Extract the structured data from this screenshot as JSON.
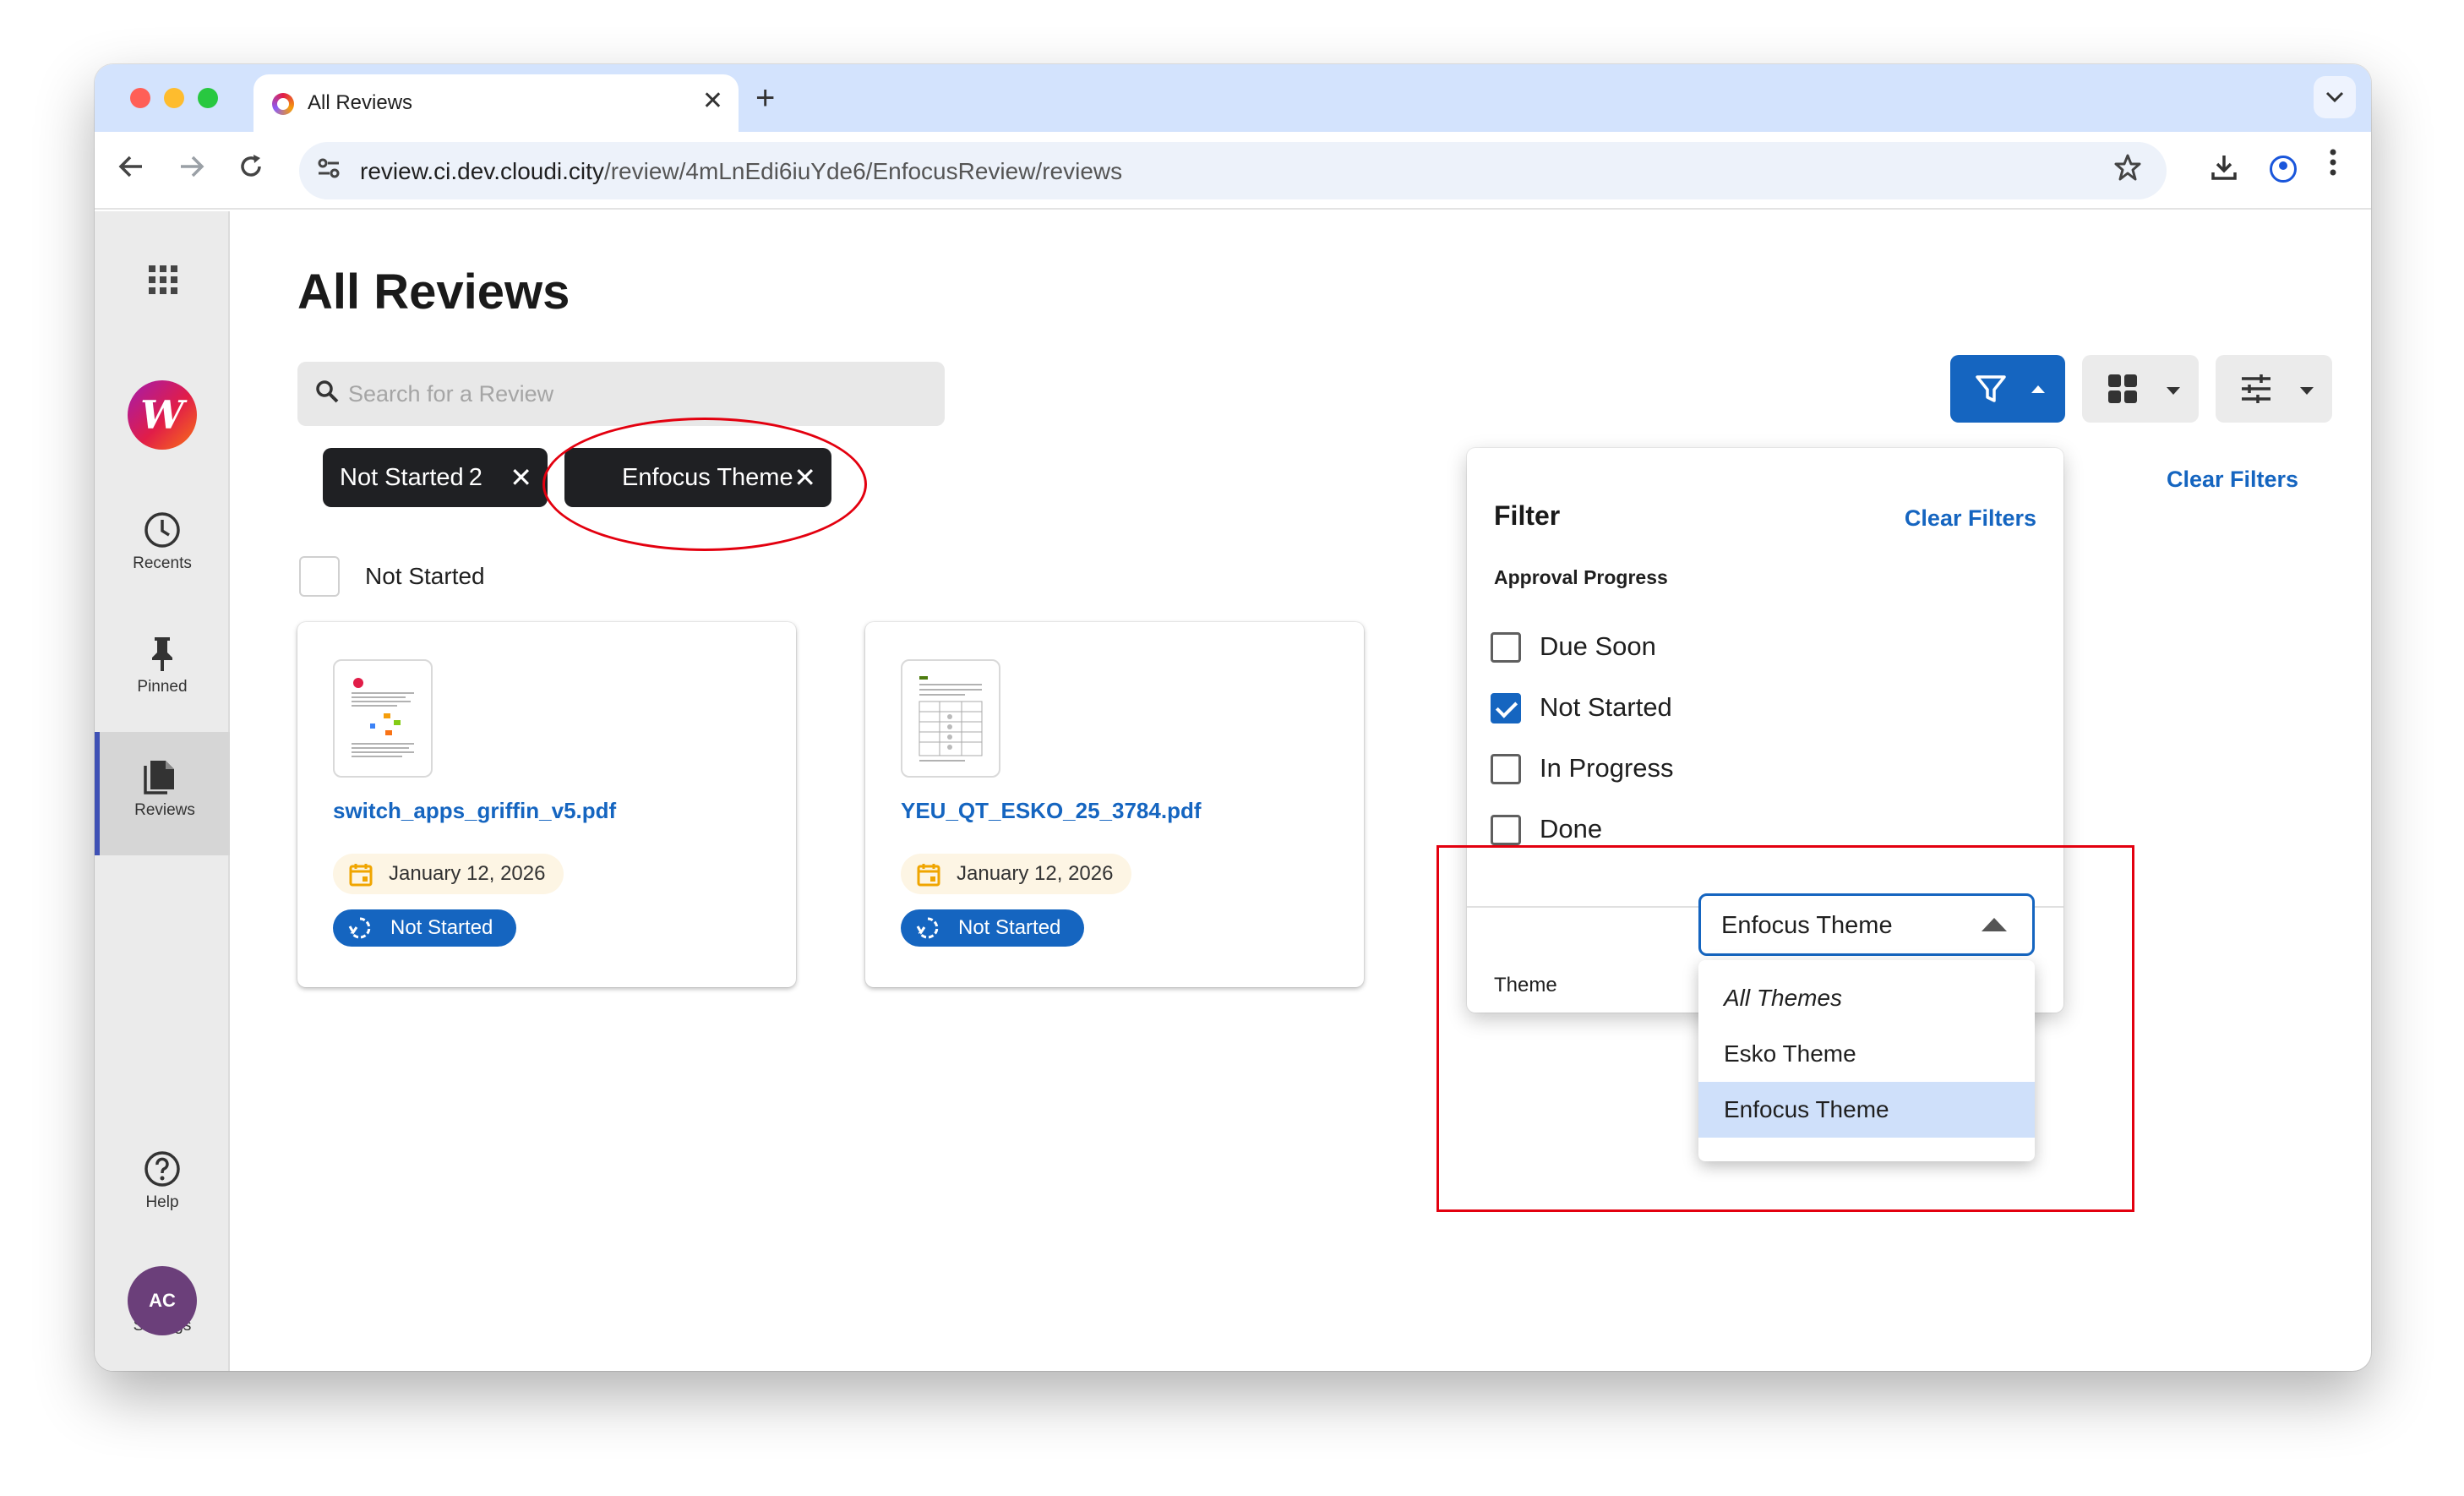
{
  "browser": {
    "tab_title": "All Reviews",
    "tab_close": "✕",
    "new_tab": "+",
    "url_domain": "review.ci.dev.cloudi.city",
    "url_path": "/review/4mLnEdi6iuYde6/EnfocusReview/reviews",
    "icons": [
      "back-arrow-icon",
      "forward-arrow-icon",
      "reload-icon",
      "site-settings-icon",
      "bookmark-star-icon",
      "download-icon",
      "account-icon",
      "more-icon"
    ]
  },
  "sidebar": {
    "logo_glyph": "W",
    "items": [
      {
        "label": "Recents",
        "icon": "clock-icon"
      },
      {
        "label": "Pinned",
        "icon": "pin-icon"
      },
      {
        "label": "Reviews",
        "icon": "documents-icon",
        "active": true
      },
      {
        "label": "Help",
        "icon": "help-icon"
      },
      {
        "label": "Settings",
        "icon": "gear-icon"
      }
    ],
    "avatar": "AC"
  },
  "main": {
    "title": "All Reviews",
    "search_placeholder": "Search for a Review",
    "chips": [
      {
        "label": "Not Started",
        "count": "2",
        "close": "✕"
      },
      {
        "label": "Enfocus Theme",
        "close": "✕"
      }
    ],
    "group_label": "Not Started",
    "cards": [
      {
        "name": "switch_apps_griffin_v5.pdf",
        "date": "January 12, 2026",
        "status": "Not Started"
      },
      {
        "name": "YEU_QT_ESKO_25_3784.pdf",
        "date": "January 12, 2026",
        "status": "Not Started"
      }
    ],
    "clear_filters": "Clear Filters"
  },
  "filter_panel": {
    "title": "Filter",
    "clear_filters": "Clear Filters",
    "section": "Approval Progress",
    "options": [
      {
        "label": "Due Soon",
        "checked": false
      },
      {
        "label": "Not Started",
        "checked": true
      },
      {
        "label": "In Progress",
        "checked": false
      },
      {
        "label": "Done",
        "checked": false
      }
    ],
    "theme_label": "Theme",
    "theme_value": "Enfocus Theme",
    "theme_options": [
      "All Themes",
      "Esko Theme",
      "Enfocus Theme"
    ],
    "theme_selected": "Enfocus Theme"
  },
  "colors": {
    "accent": "#1565c0",
    "chip_dark": "#1f2023",
    "annotation_red": "#e3000f",
    "tab_strip": "#d3e3fd"
  }
}
